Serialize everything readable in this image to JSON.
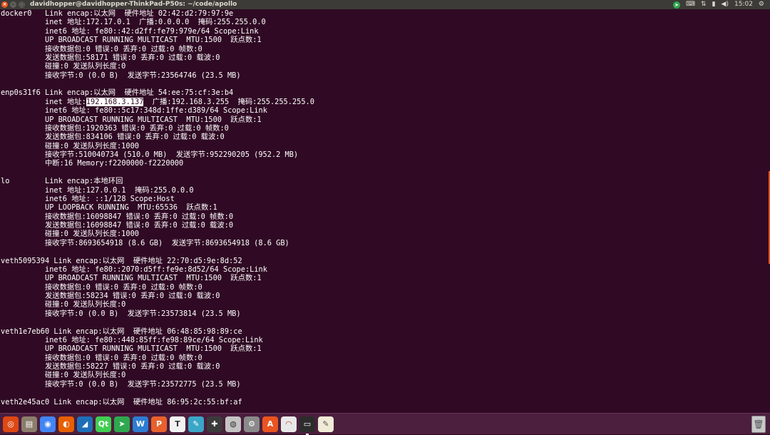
{
  "window": {
    "title": "davidhopper@davidhopper-ThinkPad-P50s: ~/code/apollo"
  },
  "tray": {
    "clock": "15:02"
  },
  "terminal": {
    "lines": [
      {
        "t": "docker0   Link encap:以太网  硬件地址 02:42:d2:79:97:9e"
      },
      {
        "t": "          inet 地址:172.17.0.1  广播:0.0.0.0  掩码:255.255.0.0"
      },
      {
        "t": "          inet6 地址: fe80::42:d2ff:fe79:979e/64 Scope:Link"
      },
      {
        "t": "          UP BROADCAST RUNNING MULTICAST  MTU:1500  跃点数:1"
      },
      {
        "t": "          接收数据包:0 错误:0 丢弃:0 过载:0 帧数:0"
      },
      {
        "t": "          发送数据包:58171 错误:0 丢弃:0 过载:0 载波:0"
      },
      {
        "t": "          碰撞:0 发送队列长度:0"
      },
      {
        "t": "          接收字节:0 (0.0 B)  发送字节:23564746 (23.5 MB)"
      },
      {
        "t": ""
      },
      {
        "t": "enp0s31f6 Link encap:以太网  硬件地址 54:ee:75:cf:3e:b4"
      },
      {
        "pre": "          inet 地址:",
        "sel": "192.168.3.137",
        "post": "  广播:192.168.3.255  掩码:255.255.255.0"
      },
      {
        "t": "          inet6 地址: fe80::5c17:348d:1ffe:d389/64 Scope:Link"
      },
      {
        "t": "          UP BROADCAST RUNNING MULTICAST  MTU:1500  跃点数:1"
      },
      {
        "t": "          接收数据包:1920363 错误:0 丢弃:0 过载:0 帧数:0"
      },
      {
        "t": "          发送数据包:834106 错误:0 丢弃:0 过载:0 载波:0"
      },
      {
        "t": "          碰撞:0 发送队列长度:1000"
      },
      {
        "t": "          接收字节:510040734 (510.0 MB)  发送字节:952290205 (952.2 MB)"
      },
      {
        "t": "          中断:16 Memory:f2200000-f2220000"
      },
      {
        "t": ""
      },
      {
        "t": "lo        Link encap:本地环回"
      },
      {
        "t": "          inet 地址:127.0.0.1  掩码:255.0.0.0"
      },
      {
        "t": "          inet6 地址: ::1/128 Scope:Host"
      },
      {
        "t": "          UP LOOPBACK RUNNING  MTU:65536  跃点数:1"
      },
      {
        "t": "          接收数据包:16098847 错误:0 丢弃:0 过载:0 帧数:0"
      },
      {
        "t": "          发送数据包:16098847 错误:0 丢弃:0 过载:0 载波:0"
      },
      {
        "t": "          碰撞:0 发送队列长度:1000"
      },
      {
        "t": "          接收字节:8693654918 (8.6 GB)  发送字节:8693654918 (8.6 GB)"
      },
      {
        "t": ""
      },
      {
        "t": "veth5095394 Link encap:以太网  硬件地址 22:70:d5:9e:8d:52"
      },
      {
        "t": "          inet6 地址: fe80::2070:d5ff:fe9e:8d52/64 Scope:Link"
      },
      {
        "t": "          UP BROADCAST RUNNING MULTICAST  MTU:1500  跃点数:1"
      },
      {
        "t": "          接收数据包:0 错误:0 丢弃:0 过载:0 帧数:0"
      },
      {
        "t": "          发送数据包:58234 错误:0 丢弃:0 过载:0 载波:0"
      },
      {
        "t": "          碰撞:0 发送队列长度:0"
      },
      {
        "t": "          接收字节:0 (0.0 B)  发送字节:23573814 (23.5 MB)"
      },
      {
        "t": ""
      },
      {
        "t": "veth1e7eb60 Link encap:以太网  硬件地址 06:48:85:98:89:ce"
      },
      {
        "t": "          inet6 地址: fe80::448:85ff:fe98:89ce/64 Scope:Link"
      },
      {
        "t": "          UP BROADCAST RUNNING MULTICAST  MTU:1500  跃点数:1"
      },
      {
        "t": "          接收数据包:0 错误:0 丢弃:0 过载:0 帧数:0"
      },
      {
        "t": "          发送数据包:58227 错误:0 丢弃:0 过载:0 载波:0"
      },
      {
        "t": "          碰撞:0 发送队列长度:0"
      },
      {
        "t": "          接收字节:0 (0.0 B)  发送字节:23572775 (23.5 MB)"
      },
      {
        "t": ""
      },
      {
        "t": "veth2e45ac0 Link encap:以太网  硬件地址 86:95:2c:55:bf:af"
      }
    ]
  },
  "launcher": {
    "apps": [
      {
        "icon": "ubuntu-dash-icon",
        "bg": "#dd4814",
        "glyph": "◎"
      },
      {
        "icon": "file-manager-icon",
        "bg": "#8b7d6b",
        "glyph": "▤"
      },
      {
        "icon": "chrome-icon",
        "bg": "#4285f4",
        "glyph": "◉"
      },
      {
        "icon": "firefox-icon",
        "bg": "#e66000",
        "glyph": "◐"
      },
      {
        "icon": "vscode-icon",
        "bg": "#1e6fb8",
        "glyph": "◢"
      },
      {
        "icon": "qt-creator-icon",
        "bg": "#41cd52",
        "glyph": "Qt"
      },
      {
        "icon": "telegram-icon",
        "bg": "#2ea84f",
        "glyph": "➤"
      },
      {
        "icon": "wps-writer-icon",
        "bg": "#2d7dd2",
        "glyph": "W"
      },
      {
        "icon": "wps-presentation-icon",
        "bg": "#e8612c",
        "glyph": "P"
      },
      {
        "icon": "typora-icon",
        "bg": "#f2f2f2",
        "glyph": "T",
        "fg": "#333333"
      },
      {
        "icon": "editor-icon",
        "bg": "#3aa7c8",
        "glyph": "✎"
      },
      {
        "icon": "gitkraken-icon",
        "bg": "#3b3b3b",
        "glyph": "✚"
      },
      {
        "icon": "disks-icon",
        "bg": "#c4c4c4",
        "glyph": "◍",
        "fg": "#333333"
      },
      {
        "icon": "system-settings-icon",
        "bg": "#8a8a8a",
        "glyph": "⚙"
      },
      {
        "icon": "software-center-icon",
        "bg": "#e95420",
        "glyph": "A"
      },
      {
        "icon": "remote-desktop-icon",
        "bg": "#e8e8e8",
        "glyph": "◠",
        "fg": "#c0392b"
      },
      {
        "icon": "terminal-icon",
        "bg": "#2c2c2c",
        "glyph": "▭",
        "active": true
      },
      {
        "icon": "text-editor-icon",
        "bg": "#f0ead6",
        "glyph": "✎",
        "fg": "#555555"
      }
    ],
    "trash_icon": "trash-icon"
  }
}
